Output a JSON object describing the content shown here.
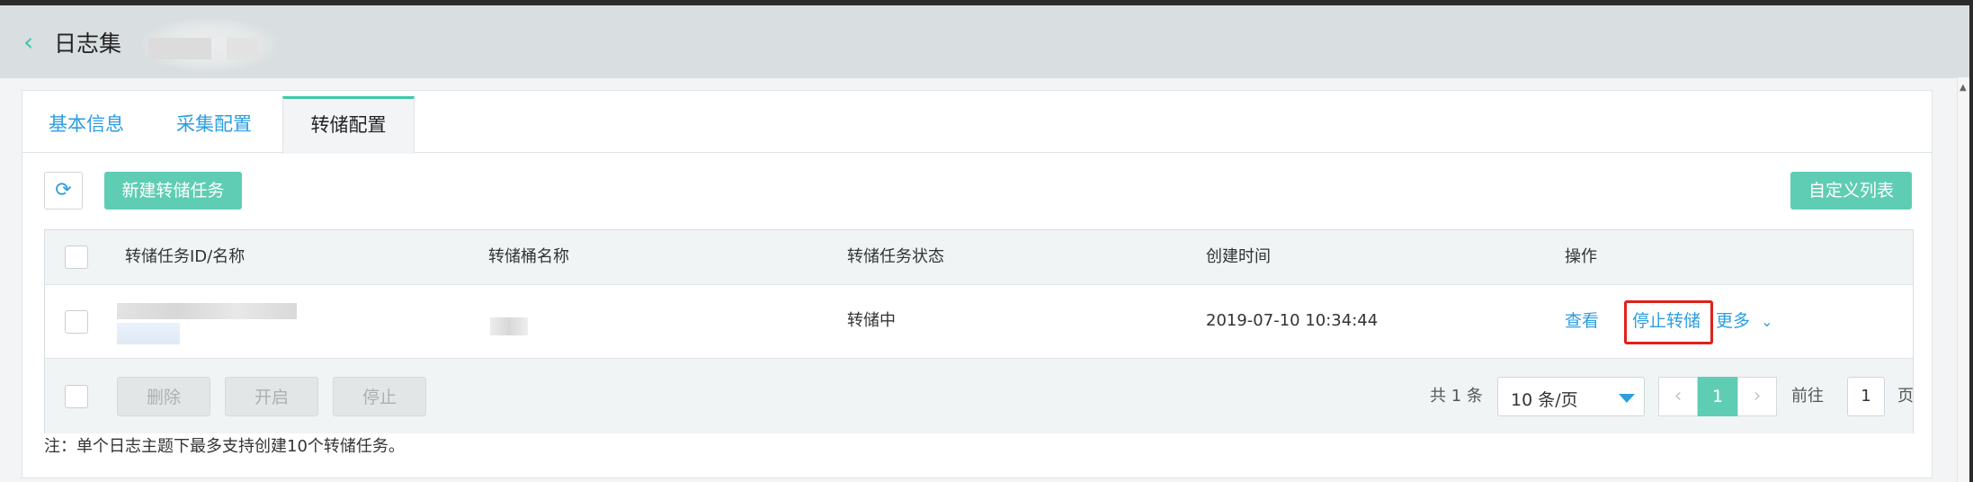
{
  "header": {
    "back_icon": "chevron-left-icon",
    "title": "日志集"
  },
  "tabs": [
    {
      "label": "基本信息",
      "active": false
    },
    {
      "label": "采集配置",
      "active": false
    },
    {
      "label": "转储配置",
      "active": true
    }
  ],
  "toolbar": {
    "refresh_icon": "refresh-icon",
    "new_task_label": "新建转储任务",
    "custom_columns_label": "自定义列表"
  },
  "table": {
    "columns": [
      "转储任务ID/名称",
      "转储桶名称",
      "转储任务状态",
      "创建时间",
      "操作"
    ],
    "rows": [
      {
        "status": "转储中",
        "created": "2019-07-10 10:34:44",
        "actions": {
          "view": "查看",
          "stop_dump": "停止转储",
          "more": "更多"
        }
      }
    ]
  },
  "footer": {
    "delete_label": "删除",
    "enable_label": "开启",
    "stop_label": "停止",
    "total_text": "共 1 条",
    "page_size": "10 条/页",
    "current_page": "1",
    "goto_prefix": "前往",
    "goto_value": "1",
    "goto_suffix": "页"
  },
  "note": "注：单个日志主题下最多支持创建10个转储任务。",
  "colors": {
    "accent_green": "#5fcdb3",
    "link_blue": "#2d9ee0",
    "highlight_red": "#e0201b"
  }
}
